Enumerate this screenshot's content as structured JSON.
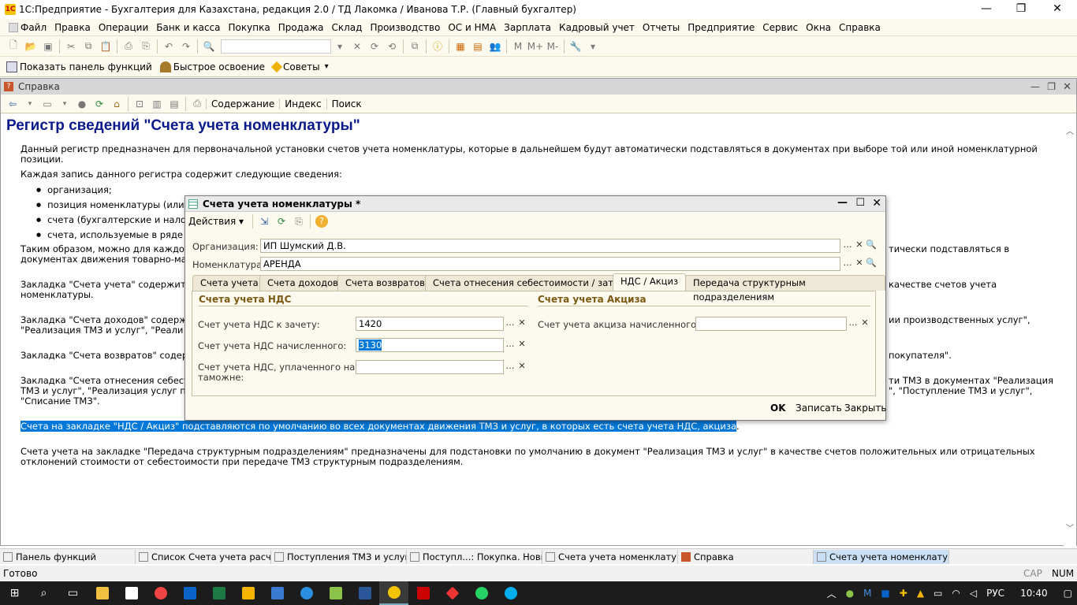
{
  "window": {
    "title": "1С:Предприятие - Бухгалтерия для Казахстана, редакция 2.0 / ТД Лакомка / Иванова Т.Р. (Главный бухгалтер)"
  },
  "menu": [
    "Файл",
    "Правка",
    "Операции",
    "Банк и касса",
    "Покупка",
    "Продажа",
    "Склад",
    "Производство",
    "ОС и НМА",
    "Зарплата",
    "Кадровый учет",
    "Отчеты",
    "Предприятие",
    "Сервис",
    "Окна",
    "Справка"
  ],
  "toolbar2": {
    "functions_panel": "Показать панель функций",
    "quick_learning": "Быстрое освоение",
    "tips": "Советы"
  },
  "help": {
    "title": "Справка",
    "toolbar": {
      "contents": "Содержание",
      "index": "Индекс",
      "search": "Поиск"
    },
    "heading": "Регистр сведений \"Счета учета номенклатуры\"",
    "p1": "Данный регистр предназначен для первоначальной установки счетов учета номенклатуры, которые в дальнейшем будут автоматически подставляться в документах при выборе той или иной номенклатурной позиции.",
    "p2": "Каждая запись данного регистра содержит следующие сведения:",
    "bullets": [
      "организация;",
      "позиция номенклатуры (или г",
      "счета (бухгалтерские и налог",
      "счета, используемые в ряде"
    ],
    "p3a": "Таким образом, можно для каждой",
    "p3b": "документах движения товарно-мат",
    "p3c": "тически подставляться в",
    "p4a": "Закладка \"Счета учета\" содержит",
    "p4b": "номенклатуры.",
    "p4c": "качестве счетов учета",
    "p5a": "Закладка \"Счета доходов\" содерж",
    "p5b": "\"Реализация ТМЗ и услуг\", \"Реали",
    "p5c": "ии производственных услуг\",",
    "p6a": "Закладка \"Счета возвратов\" содер",
    "p6c": "покупателя\".",
    "p7a": "Закладка \"Счета отнесения себест",
    "p7b": "ТМЗ и услуг\", \"Реализация услуг по",
    "p7c": "\"Списание ТМЗ\".",
    "p7d": "ти ТМЗ в документах \"Реализация",
    "p7e": "\", \"Поступление ТМЗ и услуг\",",
    "p8": "Счета на закладке \"НДС / Акциз\" подставляются по умолчанию во всех документах движения ТМЗ и услуг, в которых есть счета учета НДС, акциза",
    "p8end": ".",
    "p9a": "Счета учета на закладке \"Передача структурным подразделениям\" предназначены для подстановки по умолчанию в документ \"Реализация ТМЗ и услуг\" в качестве счетов положительных или отрицательных",
    "p9b": "отклонений стоимости от себестоимости при передаче ТМЗ структурным подразделениям."
  },
  "dialog": {
    "title": "Счета учета номенклатуры *",
    "actions": "Действия",
    "org_label": "Организация:",
    "org_value": "ИП Шумский Д.В.",
    "nom_label": "Номенклатура:",
    "nom_value": "АРЕНДА",
    "tabs": [
      "Счета учета",
      "Счета доходов",
      "Счета возвратов",
      "Счета отнесения себестоимости / затрат",
      "НДС / Акциз",
      "Передача структурным подразделениям"
    ],
    "vat_section": "Счета учета НДС",
    "excise_section": "Счета учета Акциза",
    "vat_offset_label": "Счет учета НДС к зачету:",
    "vat_offset_value": "1420",
    "vat_accrued_label": "Счет учета НДС начисленного:",
    "vat_accrued_value": "3130",
    "vat_customs_label1": "Счет учета НДС, уплаченного на",
    "vat_customs_label2": "таможне:",
    "vat_customs_value": "",
    "excise_label": "Счет учета акциза начисленного:",
    "excise_value": "",
    "ok": "OK",
    "save": "Записать",
    "close": "Закрыть"
  },
  "tasks": [
    "Панель функций",
    "Список Счета учета расчет...",
    "Поступления ТМЗ и услуг",
    "Поступл...: Покупка. Новый *",
    "Счета учета номенклатуры",
    "Справка",
    "Счета учета номенклатуры *"
  ],
  "status": {
    "text": "Готово",
    "cap": "CAP",
    "num": "NUM"
  },
  "tray": {
    "lang": "РУС",
    "time": "10:40"
  }
}
